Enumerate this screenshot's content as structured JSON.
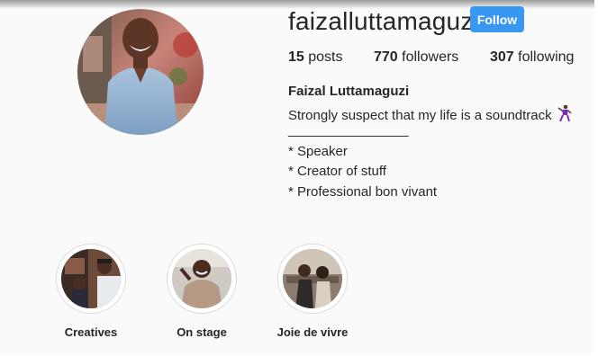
{
  "profile": {
    "username": "faizalluttamaguzi",
    "follow_label": "Follow",
    "stats": {
      "posts_count": "15",
      "posts_label": "posts",
      "followers_count": "770",
      "followers_label": "followers",
      "following_count": "307",
      "following_label": "following"
    },
    "full_name": "Faizal Luttamaguzi",
    "bio": {
      "line1": "Strongly suspect that my life is a soundtrack",
      "line1_emoji": "dancer-icon",
      "divider": "________________",
      "line2": "* Speaker",
      "line3": "* Creator of stuff",
      "line4": "* Professional bon vivant"
    }
  },
  "highlights": [
    {
      "label": "Creatives",
      "icon": "creatives-thumbnail"
    },
    {
      "label": "On stage",
      "icon": "on-stage-thumbnail"
    },
    {
      "label": "Joie de vivre",
      "icon": "joie-de-vivre-thumbnail"
    }
  ],
  "colors": {
    "follow_button": "#3897f0",
    "text": "#262626",
    "page_background": "#fafafa",
    "highlight_ring": "#dbdbdb"
  }
}
